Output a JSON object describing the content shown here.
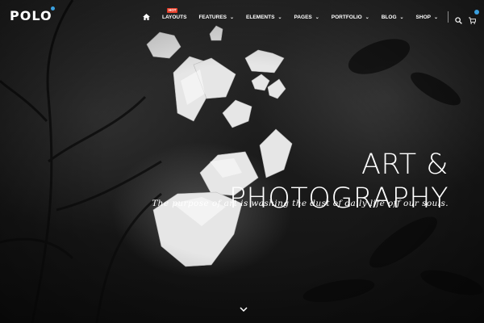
{
  "logo": {
    "text": "POLO"
  },
  "nav": {
    "items": [
      {
        "label": "LAYOUTS",
        "badge": "HOT"
      },
      {
        "label": "FEATURES"
      },
      {
        "label": "ELEMENTS"
      },
      {
        "label": "PAGES"
      },
      {
        "label": "PORTFOLIO"
      },
      {
        "label": "BLOG"
      },
      {
        "label": "SHOP"
      }
    ],
    "icons": [
      "home-icon",
      "search-icon",
      "cart-icon",
      "chevron-down-icon"
    ]
  },
  "hero": {
    "title_line1": "ART &",
    "title_line2": "PHOTOGRAPHY",
    "subtitle": "The purpose of art is washing the dust of daily life off our souls."
  },
  "colors": {
    "accent": "#3aa0e0",
    "hot": "#e8402b",
    "text": "#ffffff"
  }
}
